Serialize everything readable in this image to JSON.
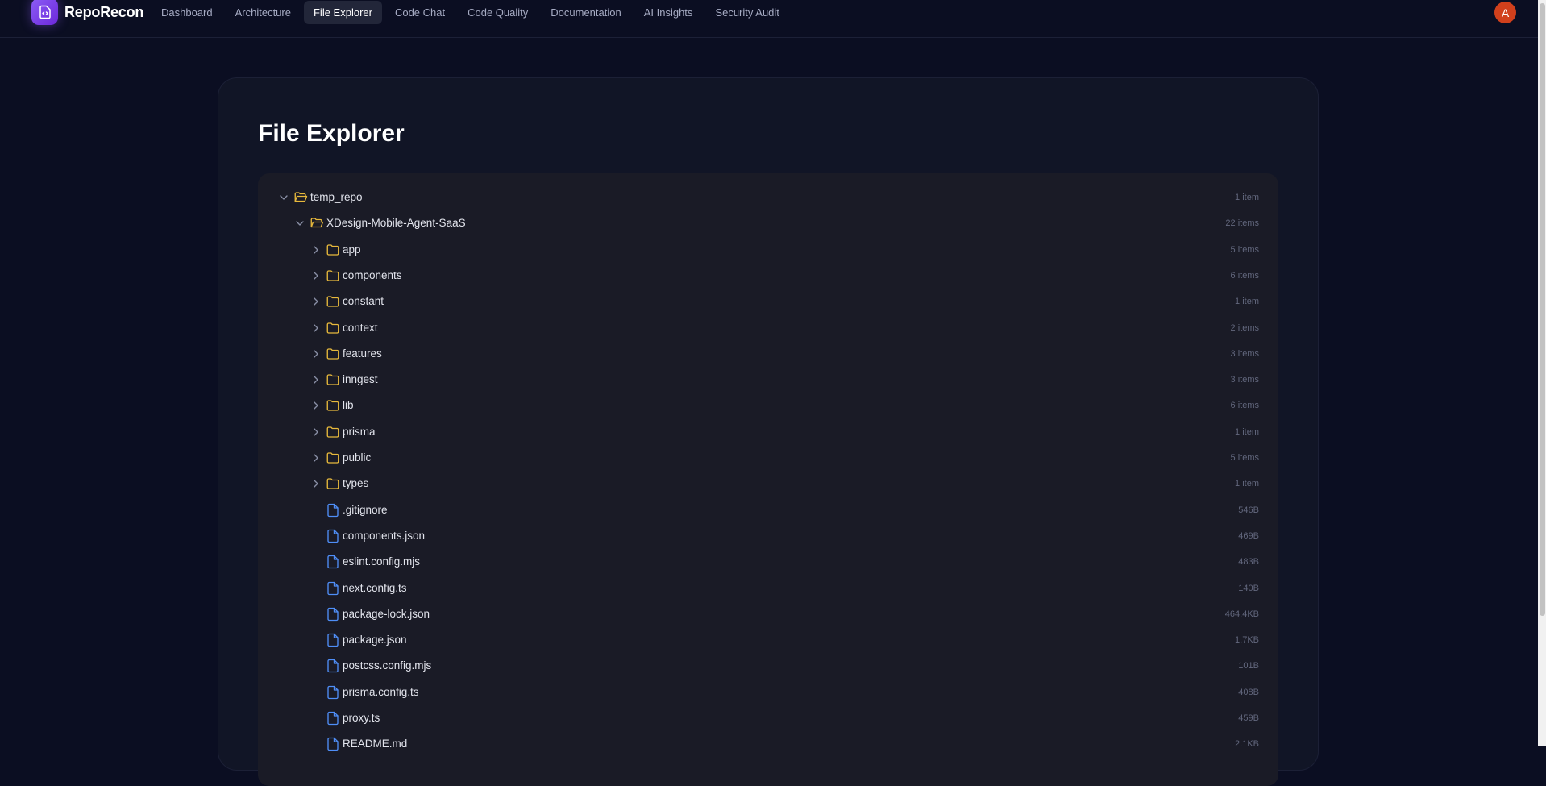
{
  "app": {
    "name": "RepoRecon",
    "avatar_letter": "A"
  },
  "nav": [
    {
      "label": "Dashboard",
      "active": false
    },
    {
      "label": "Architecture",
      "active": false
    },
    {
      "label": "File Explorer",
      "active": true
    },
    {
      "label": "Code Chat",
      "active": false
    },
    {
      "label": "Code Quality",
      "active": false
    },
    {
      "label": "Documentation",
      "active": false
    },
    {
      "label": "AI Insights",
      "active": false
    },
    {
      "label": "Security Audit",
      "active": false
    }
  ],
  "page": {
    "title": "File Explorer"
  },
  "colors": {
    "folder": "#e7b93c",
    "file": "#4f8ef7",
    "accent": "#8b5cf6",
    "avatar": "#d1401c"
  },
  "tree": [
    {
      "name": "temp_repo",
      "type": "folder",
      "open": true,
      "depth": 0,
      "meta": "1 item"
    },
    {
      "name": "XDesign-Mobile-Agent-SaaS",
      "type": "folder",
      "open": true,
      "depth": 1,
      "meta": "22 items"
    },
    {
      "name": "app",
      "type": "folder",
      "open": false,
      "depth": 2,
      "meta": "5 items"
    },
    {
      "name": "components",
      "type": "folder",
      "open": false,
      "depth": 2,
      "meta": "6 items"
    },
    {
      "name": "constant",
      "type": "folder",
      "open": false,
      "depth": 2,
      "meta": "1 item"
    },
    {
      "name": "context",
      "type": "folder",
      "open": false,
      "depth": 2,
      "meta": "2 items"
    },
    {
      "name": "features",
      "type": "folder",
      "open": false,
      "depth": 2,
      "meta": "3 items"
    },
    {
      "name": "inngest",
      "type": "folder",
      "open": false,
      "depth": 2,
      "meta": "3 items"
    },
    {
      "name": "lib",
      "type": "folder",
      "open": false,
      "depth": 2,
      "meta": "6 items"
    },
    {
      "name": "prisma",
      "type": "folder",
      "open": false,
      "depth": 2,
      "meta": "1 item"
    },
    {
      "name": "public",
      "type": "folder",
      "open": false,
      "depth": 2,
      "meta": "5 items"
    },
    {
      "name": "types",
      "type": "folder",
      "open": false,
      "depth": 2,
      "meta": "1 item"
    },
    {
      "name": ".gitignore",
      "type": "file",
      "depth": 2,
      "meta": "546B"
    },
    {
      "name": "components.json",
      "type": "file",
      "depth": 2,
      "meta": "469B"
    },
    {
      "name": "eslint.config.mjs",
      "type": "file",
      "depth": 2,
      "meta": "483B"
    },
    {
      "name": "next.config.ts",
      "type": "file",
      "depth": 2,
      "meta": "140B"
    },
    {
      "name": "package-lock.json",
      "type": "file",
      "depth": 2,
      "meta": "464.4KB"
    },
    {
      "name": "package.json",
      "type": "file",
      "depth": 2,
      "meta": "1.7KB"
    },
    {
      "name": "postcss.config.mjs",
      "type": "file",
      "depth": 2,
      "meta": "101B"
    },
    {
      "name": "prisma.config.ts",
      "type": "file",
      "depth": 2,
      "meta": "408B"
    },
    {
      "name": "proxy.ts",
      "type": "file",
      "depth": 2,
      "meta": "459B"
    },
    {
      "name": "README.md",
      "type": "file",
      "depth": 2,
      "meta": "2.1KB"
    }
  ]
}
